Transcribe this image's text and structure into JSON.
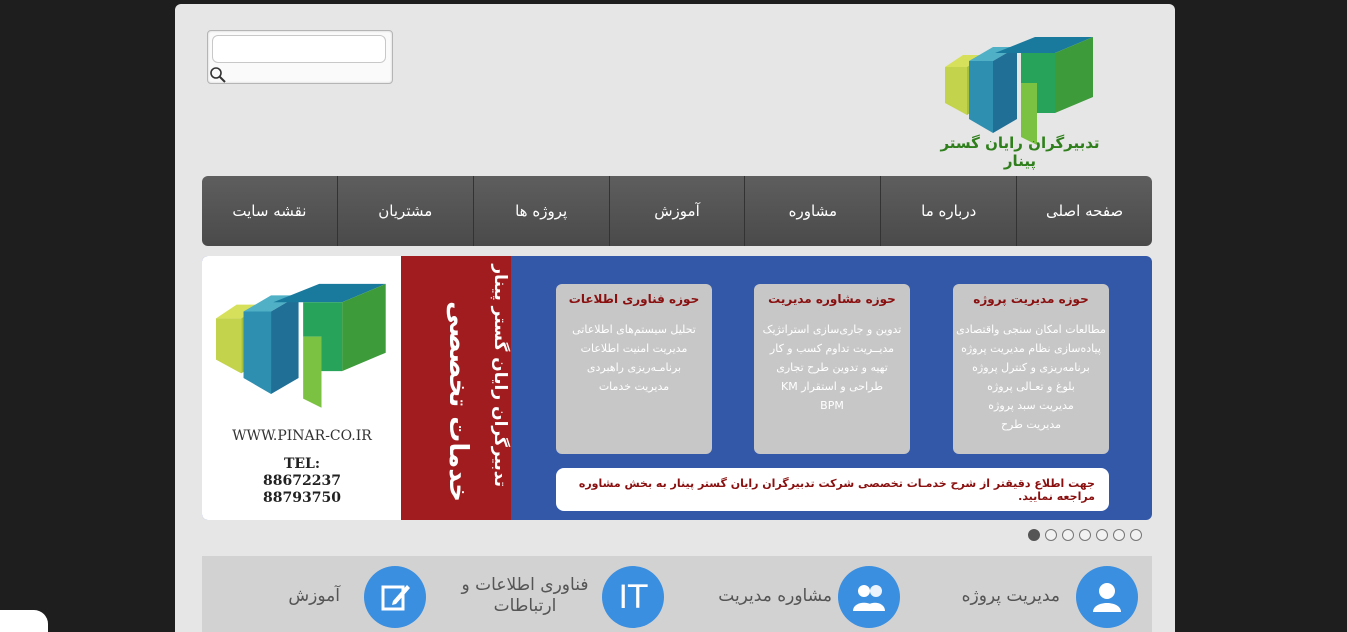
{
  "search": {
    "value": "",
    "placeholder": ""
  },
  "logo": {
    "text": "تدبیرگران رایان گستر پینار"
  },
  "nav": {
    "items": [
      "صفحه اصلی",
      "درباره ما",
      "مشاوره",
      "آموزش",
      "پروژه ها",
      "مشتریان",
      "نقشه سایت"
    ]
  },
  "banner": {
    "url": "WWW.PINAR-CO.IR",
    "tel_label": "TEL:",
    "tel_1": "88672237",
    "tel_2": "88793750",
    "red_title": "خدمات تخصصی",
    "red_subtitle": "تدبیرگران رایان گستر پینار",
    "cards": [
      {
        "title": "حوزه مدیریت پروژه",
        "lines": [
          "مطالعات امکان سنجی واقتصادی",
          "پیاده‌سازی نظام مدیریت پروژه",
          "برنامه‌ریزی و کنترل پروژه",
          "بلوغ و تعـالی پروژه",
          "مدیریت سبد پروژه",
          "مدیریت طرح"
        ]
      },
      {
        "title": "حوزه مشاوره مدیریت",
        "lines": [
          "تدوین و جاری‌سازی استراتژیک",
          "مدیــریت تداوم کسب و کار",
          "تهیه و تدوین طرح تجاری",
          "طراحی و استقرار KM",
          "BPM"
        ]
      },
      {
        "title": "حوزه فناوری اطلاعات",
        "lines": [
          "تحلیل سیستم‌های اطلاعاتی",
          "مدیریت امنیت اطلاعات",
          "برنامـه‌ریزی راهبردی",
          "مدیریت خدمات"
        ]
      }
    ],
    "note": "جهت اطلاع دقیقتر از شرح خدمـات تخصصی شرکت تدبیرگران رایان گستر پینار به بخش مشاوره مراجعه نمایید."
  },
  "slider": {
    "count": 7,
    "active": 7
  },
  "services": [
    {
      "label": "مدیریت پروژه",
      "icon": "user-icon"
    },
    {
      "label": "مشاوره مدیریت",
      "icon": "users-icon"
    },
    {
      "label": "فناوری اطلاعات و ارتباطات",
      "icon": "it-icon",
      "icon_text": "IT"
    },
    {
      "label": "آموزش",
      "icon": "edit-icon"
    }
  ],
  "colors": {
    "nav_bg": "#555555",
    "banner_blue": "#3458a8",
    "banner_red": "#a01c1e",
    "service_blue": "#3a8fe0",
    "logo_green": "#2f7f1c"
  }
}
